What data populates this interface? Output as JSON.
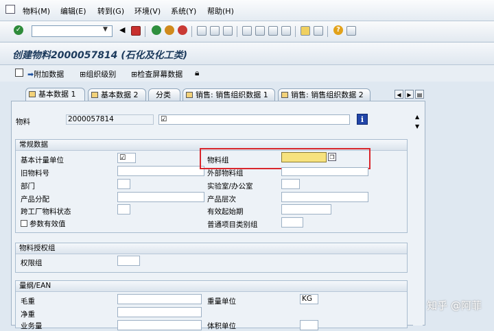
{
  "menu": [
    "物料(M)",
    "编辑(E)",
    "转到(G)",
    "环境(V)",
    "系统(Y)",
    "帮助(H)"
  ],
  "title": "创建物料2000057814 (石化及化工类)",
  "app_toolbar": [
    "附加数据",
    "组织级别",
    "检查屏幕数据"
  ],
  "tabs": [
    "基本数据 1",
    "基本数据 2",
    "分类",
    "销售: 销售组织数据 1",
    "销售: 销售组织数据 2"
  ],
  "header": {
    "material_label": "物料",
    "material_value": "2000057814",
    "description_value": "☑"
  },
  "general": {
    "title": "常规数据",
    "base_uom_label": "基本计量单位",
    "base_uom_value": "☑",
    "old_material_label": "旧物料号",
    "division_label": "部门",
    "product_alloc_label": "产品分配",
    "xplant_status_label": "跨工厂物料状态",
    "param_effect_label": "参数有效值",
    "material_group_label": "物料组",
    "ext_material_group_label": "外部物料组",
    "lab_office_label": "实验室/办公室",
    "product_hierarchy_label": "产品层次",
    "valid_from_label": "有效起始期",
    "gen_item_cat_label": "普通项目类别组"
  },
  "auth_group": {
    "title": "物料授权组",
    "auth_label": "权限组"
  },
  "dimensions": {
    "title": "量纲/EAN",
    "gross_weight_label": "毛重",
    "net_weight_label": "净重",
    "volume_label": "业务量",
    "weight_unit_label": "重量单位",
    "weight_unit_value": "KG",
    "volume_unit_label": "体积单位"
  },
  "watermark": "知乎 @阿菲",
  "colors": {
    "highlight_box": "#d9262c",
    "active_field": "#f7e27e",
    "title_text": "#1c3a5c"
  }
}
